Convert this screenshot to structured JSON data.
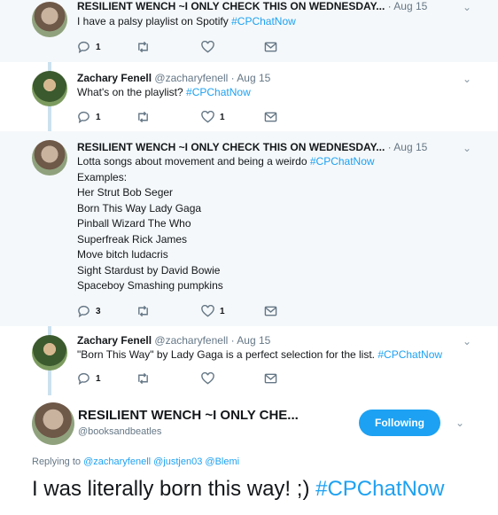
{
  "tweets": [
    {
      "name": "RESILIENT WENCH ~I ONLY CHECK THIS ON WEDNESDAY...",
      "handle": "",
      "time": "· Aug 15",
      "text": "I have a palsy playlist on Spotify",
      "hashtag": "#CPChatNow",
      "reply_count": "1",
      "retweet_count": "",
      "like_count": ""
    },
    {
      "name": "Zachary Fenell",
      "handle": "@zacharyfenell",
      "time": "· Aug 15",
      "text": "What's on the playlist?",
      "hashtag": "#CPChatNow",
      "reply_count": "1",
      "retweet_count": "",
      "like_count": "1"
    },
    {
      "name": "RESILIENT WENCH ~I ONLY CHECK THIS ON WEDNESDAY...",
      "handle": "",
      "time": "· Aug 15",
      "text": "Lotta songs about movement and being a weirdo",
      "hashtag": "#CPChatNow",
      "lines": [
        "Examples:",
        "Her Strut Bob Seger",
        "Born This Way Lady Gaga",
        "Pinball Wizard The Who",
        "Superfreak Rick James",
        "Move bitch ludacris",
        "Sight Stardust by David Bowie",
        "Spaceboy Smashing pumpkins"
      ],
      "reply_count": "3",
      "retweet_count": "",
      "like_count": "1"
    },
    {
      "name": "Zachary Fenell",
      "handle": "@zacharyfenell",
      "time": "· Aug 15",
      "text": "\"Born This Way\" by Lady Gaga is a perfect selection for the list.",
      "hashtag": "#CPChatNow",
      "reply_count": "1",
      "retweet_count": "",
      "like_count": ""
    }
  ],
  "main": {
    "name": "RESILIENT WENCH ~I ONLY CHE...",
    "handle": "@booksandbeatles",
    "follow_label": "Following",
    "replying_prefix": "Replying to",
    "replying_users": "@zacharyfenell @justjen03 @Blemi",
    "text": "I was literally born this way! ;)",
    "hashtag": "#CPChatNow"
  },
  "icons": {
    "reply": "reply-icon",
    "retweet": "retweet-icon",
    "like": "heart-icon",
    "dm": "envelope-icon",
    "more": "chevron-down-icon"
  },
  "colors": {
    "accent": "#1da1f2",
    "thread_line": "#cce1ef",
    "highlight_bg": "#f5f8fa"
  }
}
